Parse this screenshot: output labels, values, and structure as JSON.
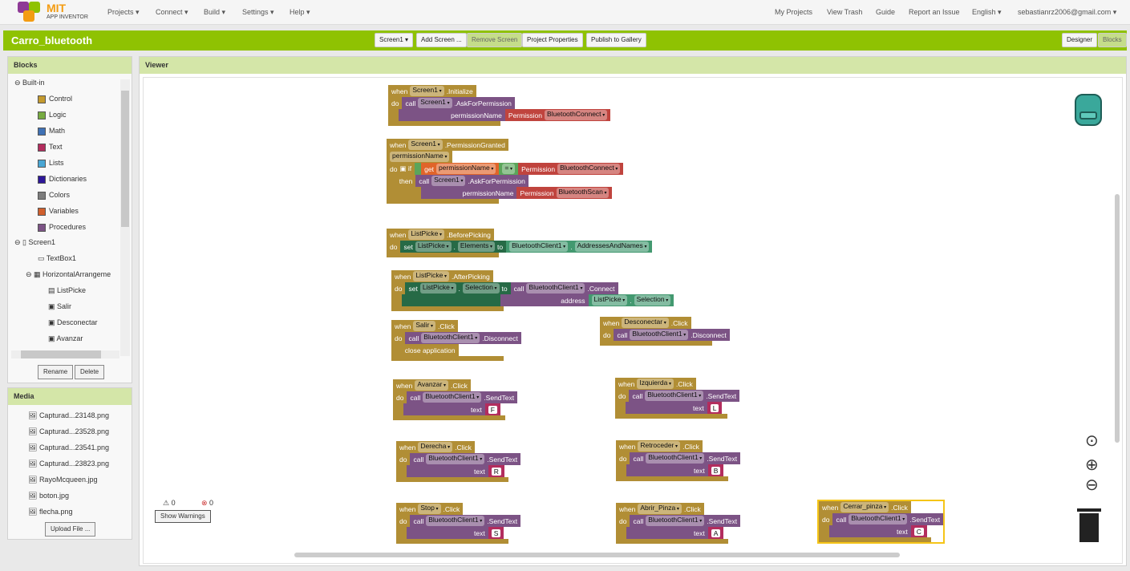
{
  "app": {
    "logo_main": "MIT",
    "logo_sub": "APP INVENTOR"
  },
  "nav": {
    "menus": [
      "Projects ▾",
      "Connect ▾",
      "Build ▾",
      "Settings ▾",
      "Help ▾"
    ],
    "right": [
      "My Projects",
      "View Trash",
      "Guide",
      "Report an Issue",
      "English ▾",
      "sebastianrz2006@gmail.com ▾"
    ]
  },
  "project": {
    "title": "Carro_bluetooth",
    "screen": "Screen1 ▾",
    "add_screen": "Add Screen ...",
    "remove_screen": "Remove Screen",
    "properties": "Project Properties",
    "publish": "Publish to Gallery",
    "designer": "Designer",
    "blocks": "Blocks"
  },
  "blocks_panel": {
    "title": "Blocks",
    "builtin": "Built-in",
    "builtin_items": [
      {
        "label": "Control",
        "color": "#c49a2e"
      },
      {
        "label": "Logic",
        "color": "#77ab41"
      },
      {
        "label": "Math",
        "color": "#3f71b5"
      },
      {
        "label": "Text",
        "color": "#b32d5e"
      },
      {
        "label": "Lists",
        "color": "#49a6d4"
      },
      {
        "label": "Dictionaries",
        "color": "#2d1799"
      },
      {
        "label": "Colors",
        "color": "#7d7d7d"
      },
      {
        "label": "Variables",
        "color": "#d05f2d"
      },
      {
        "label": "Procedures",
        "color": "#7c5385"
      }
    ],
    "components": [
      "Screen1",
      "TextBox1",
      "HorizontalArrangeme",
      "ListPicke",
      "Salir",
      "Desconectar",
      "Avanzar"
    ],
    "rename": "Rename",
    "delete": "Delete"
  },
  "media": {
    "title": "Media",
    "files": [
      "Capturad...23148.png",
      "Capturad...23528.png",
      "Capturad...23541.png",
      "Capturad...23823.png",
      "RayoMcqueen.jpg",
      "boton.jpg",
      "flecha.png"
    ],
    "upload": "Upload File ..."
  },
  "viewer": {
    "title": "Viewer",
    "warnings": "0",
    "errors": "0",
    "show_warnings": "Show Warnings"
  },
  "colors": {
    "event": "#b18e35",
    "proc": "#7c5385",
    "perm": "#c0443e",
    "text": "#b32d5e",
    "logic": "#5ba55b",
    "set": "#266a46",
    "comp": "#439970",
    "get": "#e0642a",
    "param": "#e8907a"
  },
  "blocks": [
    {
      "rows": [
        [
          {
            "c": "event",
            "tk": [
              "when",
              {
                "dd": "Screen1"
              },
              ".Initialize"
            ]
          }
        ],
        [
          {
            "c": "event",
            "tk": [
              "do"
            ]
          },
          {
            "c": "proc",
            "tk": [
              "call",
              {
                "dd": "Screen1"
              },
              ".AskForPermission"
            ]
          }
        ],
        [
          {
            "c": "event",
            "tk": [
              "  "
            ]
          },
          {
            "c": "proc",
            "tk": [
              "                          permissionName"
            ]
          },
          {
            "c": "perm",
            "tk": [
              "Permission",
              {
                "dd": "BluetoothConnect"
              }
            ]
          }
        ]
      ]
    },
    {
      "rows": [
        [
          {
            "c": "event",
            "tk": [
              "when",
              {
                "dd": "Screen1"
              },
              ".PermissionGranted"
            ]
          }
        ],
        [
          {
            "c": "event",
            "tk": [
              {
                "dd": "permissionName"
              }
            ]
          }
        ],
        [
          {
            "c": "event",
            "tk": [
              "do",
              "▣ if"
            ]
          },
          {
            "c": "logic",
            "tk": []
          },
          {
            "c": "get",
            "tk": [
              "get",
              {
                "dd": "permissionName"
              }
            ]
          },
          {
            "c": "logic",
            "tk": [
              {
                "dd": "="
              }
            ]
          },
          {
            "c": "perm",
            "tk": [
              "Permission",
              {
                "dd": "BluetoothConnect"
              }
            ]
          }
        ],
        [
          {
            "c": "event",
            "tk": [
              "     then"
            ]
          },
          {
            "c": "proc",
            "tk": [
              "call",
              {
                "dd": "Screen1"
              },
              ".AskForPermission"
            ]
          }
        ],
        [
          {
            "c": "event",
            "tk": [
              "               "
            ]
          },
          {
            "c": "proc",
            "tk": [
              "                    permissionName"
            ]
          },
          {
            "c": "perm",
            "tk": [
              "Permission",
              {
                "dd": "BluetoothScan"
              }
            ]
          }
        ]
      ]
    },
    {
      "rows": [
        [
          {
            "c": "event",
            "tk": [
              "when",
              {
                "dd": "ListPicke"
              },
              ".BeforePicking"
            ]
          }
        ],
        [
          {
            "c": "event",
            "tk": [
              "do"
            ]
          },
          {
            "c": "set",
            "tk": [
              "set",
              {
                "dd": "ListPicke"
              },
              ".",
              {
                "dd": "Elements"
              },
              "to"
            ]
          },
          {
            "c": "comp",
            "tk": [
              {
                "dd": "BluetoothClient1"
              },
              ".",
              {
                "dd": "AddressesAndNames"
              }
            ]
          }
        ]
      ]
    },
    {
      "rows": [
        [
          {
            "c": "event",
            "tk": [
              "when",
              {
                "dd": "ListPicke"
              },
              ".AfterPicking"
            ]
          }
        ],
        [
          {
            "c": "event",
            "tk": [
              "do"
            ]
          },
          {
            "c": "set",
            "tk": [
              "set",
              {
                "dd": "ListPicke"
              },
              ".",
              {
                "dd": "Selection"
              },
              "to"
            ]
          },
          {
            "c": "proc",
            "tk": [
              "call",
              {
                "dd": "BluetoothClient1"
              },
              ".Connect"
            ]
          }
        ],
        [
          {
            "c": "event",
            "tk": [
              "  "
            ]
          },
          {
            "c": "set",
            "tk": [
              "                                                 "
            ]
          },
          {
            "c": "proc",
            "tk": [
              "                              address"
            ]
          },
          {
            "c": "comp",
            "tk": [
              {
                "dd": "ListPicke"
              },
              ".",
              {
                "dd": "Selection"
              }
            ]
          }
        ]
      ]
    },
    {
      "rows": [
        [
          {
            "c": "event",
            "tk": [
              "when",
              {
                "dd": "Salir"
              },
              ".Click"
            ]
          }
        ],
        [
          {
            "c": "event",
            "tk": [
              "do"
            ]
          },
          {
            "c": "proc",
            "tk": [
              "call",
              {
                "dd": "BluetoothClient1"
              },
              ".Disconnect"
            ]
          }
        ],
        [
          {
            "c": "event",
            "tk": [
              "  "
            ]
          },
          {
            "c": "event",
            "tk": [
              "close application"
            ]
          }
        ]
      ]
    },
    {
      "rows": [
        [
          {
            "c": "event",
            "tk": [
              "when",
              {
                "dd": "Desconectar"
              },
              ".Click"
            ]
          }
        ],
        [
          {
            "c": "event",
            "tk": [
              "do"
            ]
          },
          {
            "c": "proc",
            "tk": [
              "call",
              {
                "dd": "BluetoothClient1"
              },
              ".Disconnect"
            ]
          }
        ]
      ]
    },
    {
      "rows": [
        [
          {
            "c": "event",
            "tk": [
              "when",
              {
                "dd": "Avanzar"
              },
              ".Click"
            ]
          }
        ],
        [
          {
            "c": "event",
            "tk": [
              "do"
            ]
          },
          {
            "c": "proc",
            "tk": [
              "call",
              {
                "dd": "BluetoothClient1"
              },
              ".SendText"
            ]
          }
        ],
        [
          {
            "c": "event",
            "tk": [
              "  "
            ]
          },
          {
            "c": "proc",
            "tk": [
              "                                  text"
            ]
          },
          {
            "c": "text",
            "tk": [
              {
                "lit": "F"
              }
            ]
          }
        ]
      ]
    },
    {
      "rows": [
        [
          {
            "c": "event",
            "tk": [
              "when",
              {
                "dd": "Izquierda"
              },
              ".Click"
            ]
          }
        ],
        [
          {
            "c": "event",
            "tk": [
              "do"
            ]
          },
          {
            "c": "proc",
            "tk": [
              "call",
              {
                "dd": "BluetoothClient1"
              },
              ".SendText"
            ]
          }
        ],
        [
          {
            "c": "event",
            "tk": [
              "  "
            ]
          },
          {
            "c": "proc",
            "tk": [
              "                                  text"
            ]
          },
          {
            "c": "text",
            "tk": [
              {
                "lit": "L"
              }
            ]
          }
        ]
      ]
    },
    {
      "rows": [
        [
          {
            "c": "event",
            "tk": [
              "when",
              {
                "dd": "Derecha"
              },
              ".Click"
            ]
          }
        ],
        [
          {
            "c": "event",
            "tk": [
              "do"
            ]
          },
          {
            "c": "proc",
            "tk": [
              "call",
              {
                "dd": "BluetoothClient1"
              },
              ".SendText"
            ]
          }
        ],
        [
          {
            "c": "event",
            "tk": [
              "  "
            ]
          },
          {
            "c": "proc",
            "tk": [
              "                                  text"
            ]
          },
          {
            "c": "text",
            "tk": [
              {
                "lit": "R"
              }
            ]
          }
        ]
      ]
    },
    {
      "rows": [
        [
          {
            "c": "event",
            "tk": [
              "when",
              {
                "dd": "Retroceder"
              },
              ".Click"
            ]
          }
        ],
        [
          {
            "c": "event",
            "tk": [
              "do"
            ]
          },
          {
            "c": "proc",
            "tk": [
              "call",
              {
                "dd": "BluetoothClient1"
              },
              ".SendText"
            ]
          }
        ],
        [
          {
            "c": "event",
            "tk": [
              "  "
            ]
          },
          {
            "c": "proc",
            "tk": [
              "                                  text"
            ]
          },
          {
            "c": "text",
            "tk": [
              {
                "lit": "B"
              }
            ]
          }
        ]
      ]
    },
    {
      "rows": [
        [
          {
            "c": "event",
            "tk": [
              "when",
              {
                "dd": "Stop"
              },
              ".Click"
            ]
          }
        ],
        [
          {
            "c": "event",
            "tk": [
              "do"
            ]
          },
          {
            "c": "proc",
            "tk": [
              "call",
              {
                "dd": "BluetoothClient1"
              },
              ".SendText"
            ]
          }
        ],
        [
          {
            "c": "event",
            "tk": [
              "  "
            ]
          },
          {
            "c": "proc",
            "tk": [
              "                                  text"
            ]
          },
          {
            "c": "text",
            "tk": [
              {
                "lit": "S"
              }
            ]
          }
        ]
      ]
    },
    {
      "rows": [
        [
          {
            "c": "event",
            "tk": [
              "when",
              {
                "dd": "Abrir_Pinza"
              },
              ".Click"
            ]
          }
        ],
        [
          {
            "c": "event",
            "tk": [
              "do"
            ]
          },
          {
            "c": "proc",
            "tk": [
              "call",
              {
                "dd": "BluetoothClient1"
              },
              ".SendText"
            ]
          }
        ],
        [
          {
            "c": "event",
            "tk": [
              "  "
            ]
          },
          {
            "c": "proc",
            "tk": [
              "                                  text"
            ]
          },
          {
            "c": "text",
            "tk": [
              {
                "lit": "A"
              }
            ]
          }
        ]
      ]
    },
    {
      "selected": true,
      "rows": [
        [
          {
            "c": "event",
            "tk": [
              "when",
              {
                "dd": "Cerrar_pinza"
              },
              ".Click"
            ]
          }
        ],
        [
          {
            "c": "event",
            "tk": [
              "do"
            ]
          },
          {
            "c": "proc",
            "tk": [
              "call",
              {
                "dd": "BluetoothClient1"
              },
              ".SendText"
            ]
          }
        ],
        [
          {
            "c": "event",
            "tk": [
              "  "
            ]
          },
          {
            "c": "proc",
            "tk": [
              "                                  text"
            ]
          },
          {
            "c": "text",
            "tk": [
              {
                "lit": "C"
              }
            ]
          }
        ]
      ]
    }
  ]
}
